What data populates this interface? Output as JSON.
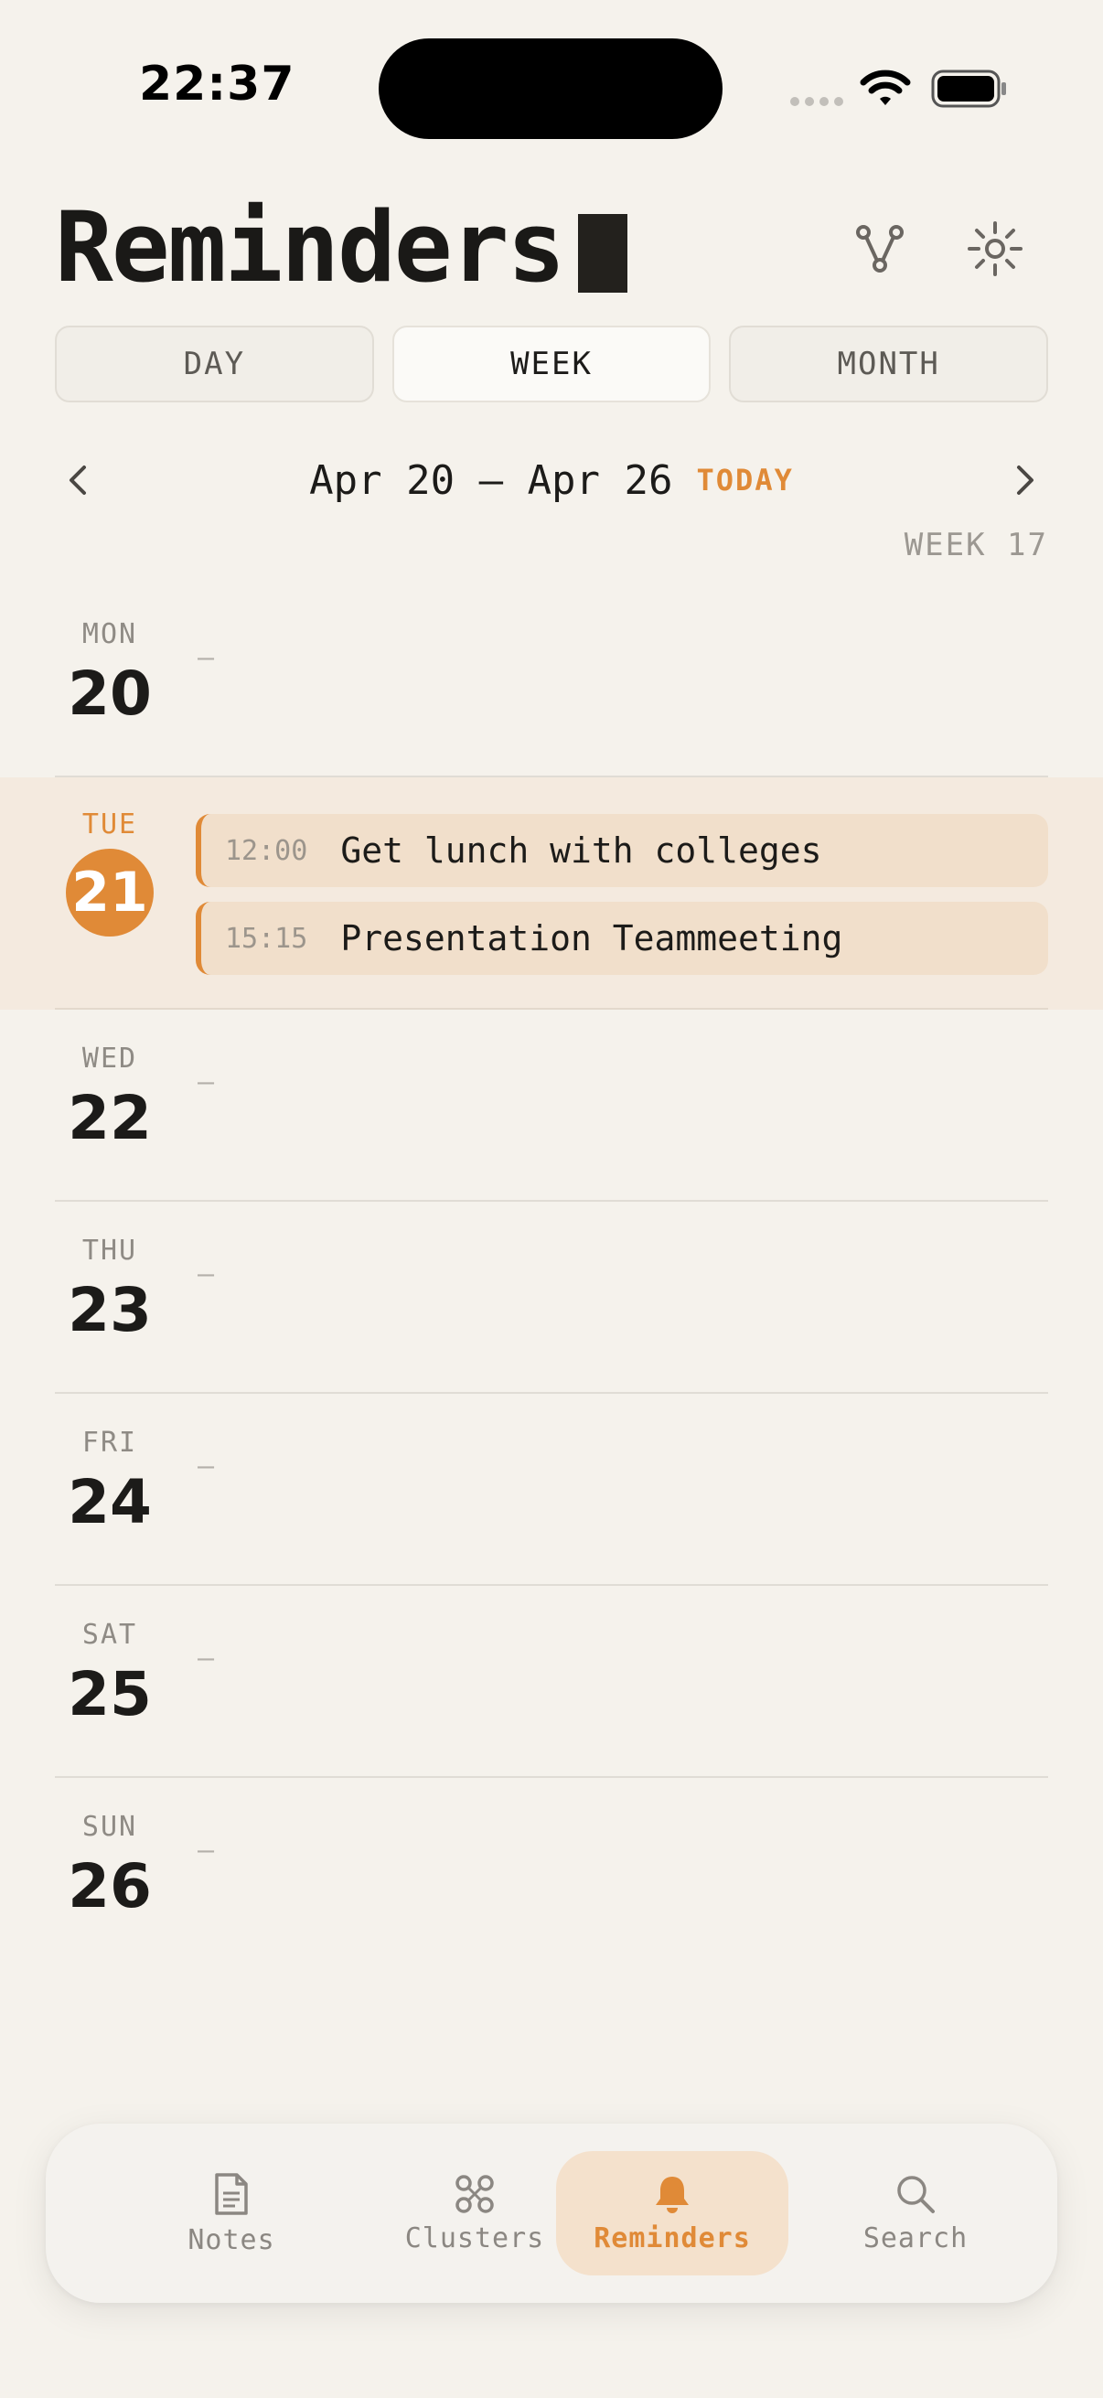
{
  "status_bar": {
    "time": "22:37"
  },
  "header": {
    "title": "Reminders"
  },
  "view_tabs": [
    {
      "label": "DAY",
      "active": false
    },
    {
      "label": "WEEK",
      "active": true
    },
    {
      "label": "MONTH",
      "active": false
    }
  ],
  "week_nav": {
    "range": "Apr 20 — Apr 26",
    "today_label": "TODAY",
    "week_label": "WEEK 17"
  },
  "days": [
    {
      "name": "MON",
      "num": "20",
      "empty": "—"
    },
    {
      "name": "TUE",
      "num": "21",
      "today": true,
      "reminders": [
        {
          "time": "12:00",
          "title": "Get lunch with colleges"
        },
        {
          "time": "15:15",
          "title": "Presentation Teammeeting"
        }
      ]
    },
    {
      "name": "WED",
      "num": "22",
      "empty": "—"
    },
    {
      "name": "THU",
      "num": "23",
      "empty": "—"
    },
    {
      "name": "FRI",
      "num": "24",
      "empty": "—"
    },
    {
      "name": "SAT",
      "num": "25",
      "empty": "—"
    },
    {
      "name": "SUN",
      "num": "26",
      "empty": "—"
    }
  ],
  "tab_bar": [
    {
      "label": "Notes",
      "icon": "notes-icon"
    },
    {
      "label": "Clusters",
      "icon": "clusters-icon"
    },
    {
      "label": "Reminders",
      "icon": "bell-icon",
      "active": true
    },
    {
      "label": "Search",
      "icon": "search-icon"
    }
  ],
  "colors": {
    "accent": "#e08a37",
    "background": "#f5f2ec",
    "today_row": "#f4eadf",
    "reminder_bg": "#f1dfcb"
  }
}
